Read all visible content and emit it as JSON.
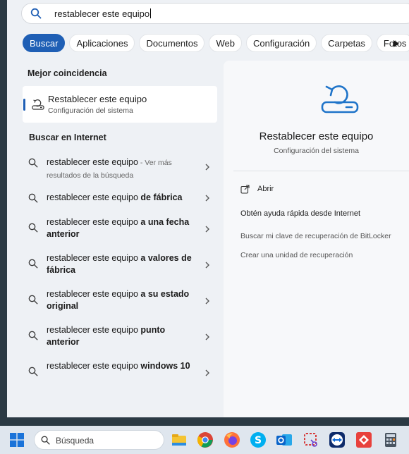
{
  "search": {
    "query": "restablecer este equipo"
  },
  "filters": [
    "Buscar",
    "Aplicaciones",
    "Documentos",
    "Web",
    "Configuración",
    "Carpetas",
    "Fotos"
  ],
  "best_match": {
    "heading": "Mejor coincidencia",
    "title": "Restablecer este equipo",
    "subtitle": "Configuración del sistema"
  },
  "web": {
    "heading": "Buscar en Internet",
    "items": [
      {
        "text": "restablecer este equipo",
        "bold": "",
        "extra": " - Ver más resultados de la búsqueda"
      },
      {
        "text": "restablecer este equipo ",
        "bold": "de fábrica",
        "extra": ""
      },
      {
        "text": "restablecer este equipo ",
        "bold": "a una fecha anterior",
        "extra": ""
      },
      {
        "text": "restablecer este equipo ",
        "bold": "a valores de fábrica",
        "extra": ""
      },
      {
        "text": "restablecer este equipo ",
        "bold": "a su estado original",
        "extra": ""
      },
      {
        "text": "restablecer este equipo ",
        "bold": "punto anterior",
        "extra": ""
      },
      {
        "text": "restablecer este equipo ",
        "bold": "windows 10",
        "extra": ""
      }
    ]
  },
  "details": {
    "title": "Restablecer este equipo",
    "subtitle": "Configuración del sistema",
    "open_label": "Abrir",
    "help_title": "Obtén ayuda rápida desde Internet",
    "links": [
      "Buscar mi clave de recuperación de BitLocker",
      "Crear una unidad de recuperación"
    ]
  },
  "taskbar": {
    "search_placeholder": "Búsqueda"
  },
  "colors": {
    "accent": "#1f5fb5",
    "panel_bg": "#eef1f5"
  }
}
